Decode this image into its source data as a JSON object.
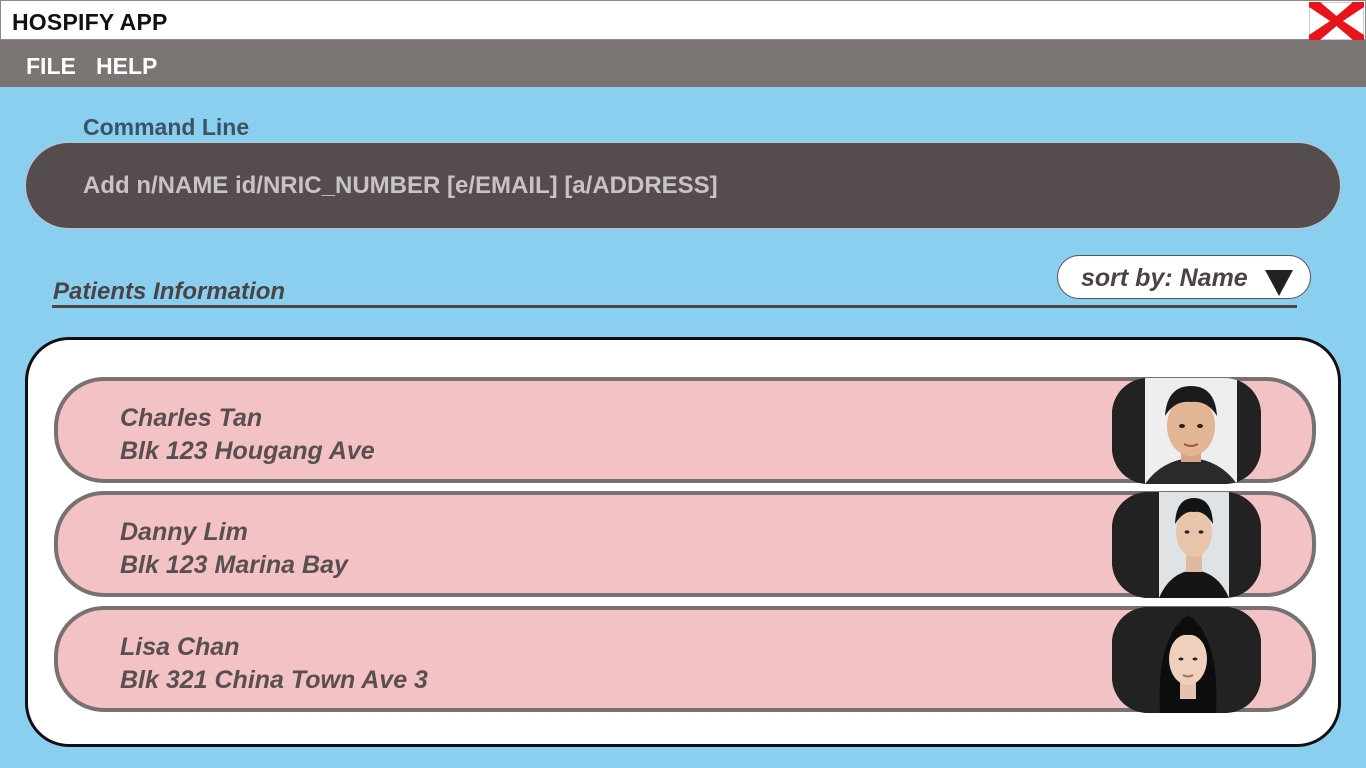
{
  "window": {
    "title": "HOSPIFY APP",
    "close_icon": "close-icon"
  },
  "menu": {
    "items": [
      {
        "label": "FILE"
      },
      {
        "label": "HELP"
      }
    ]
  },
  "command": {
    "label": "Command Line",
    "placeholder": "Add n/NAME id/NRIC_NUMBER [e/EMAIL] [a/ADDRESS]"
  },
  "patients": {
    "title": "Patients Information",
    "sort_label": "sort by: Name",
    "sort_icon": "dropdown-arrow-icon",
    "list": [
      {
        "name": "Charles Tan",
        "address": "Blk 123 Hougang Ave"
      },
      {
        "name": "Danny Lim",
        "address": "Blk 123 Marina Bay"
      },
      {
        "name": "Lisa Chan",
        "address": "Blk 321 China Town Ave 3"
      }
    ]
  },
  "colors": {
    "background": "#8acfef",
    "menubar": "#7a7473",
    "command_box": "#554c4d",
    "card": "#f2c2c4",
    "card_border": "#777172",
    "close_red": "#e8141c"
  }
}
